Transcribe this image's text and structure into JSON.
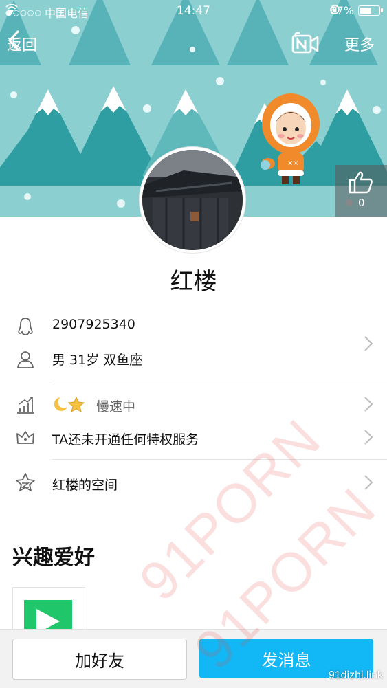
{
  "status_bar": {
    "signal": "●○○○○",
    "carrier": "中国电信",
    "time": "14:47",
    "battery": "67%",
    "battery_level": 0.67
  },
  "nav": {
    "back_label": "返回",
    "more_label": "更多",
    "video_icon": "video-call-icon"
  },
  "like": {
    "count": "0"
  },
  "profile": {
    "nickname": "红楼",
    "qq_number": "2907925340",
    "basic_info": "男 31岁 双鱼座",
    "level_status": "慢速中",
    "privilege": "TA还未开通任何特权服务",
    "space": "红楼的空间"
  },
  "interests": {
    "title": "兴趣爱好"
  },
  "actions": {
    "add_friend": "加好友",
    "send_message": "发消息"
  },
  "watermark": {
    "text_1": "91PORN",
    "text_2": "91PORN",
    "site": "91dizhi.link"
  },
  "colors": {
    "banner_bg": "#8ccfd1",
    "accent": "#12b7f5"
  }
}
